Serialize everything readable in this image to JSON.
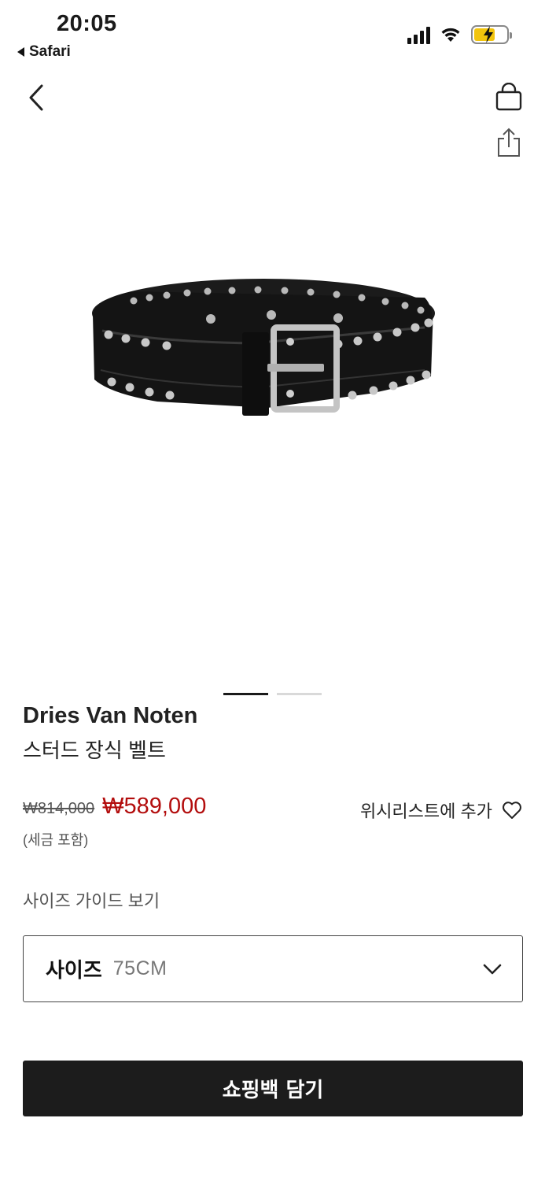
{
  "status_bar": {
    "time": "20:05",
    "back_app": "Safari",
    "icons": [
      "signal-icon",
      "wifi-icon",
      "battery-charging-icon"
    ],
    "battery_color": "#f2c40c"
  },
  "nav": {
    "back_icon": "chevron-left-icon",
    "bag_icon": "shopping-bag-icon",
    "share_icon": "share-icon"
  },
  "product": {
    "image": "studded-black-belt",
    "pager": {
      "total": 2,
      "active": 1
    },
    "brand": "Dries Van Noten",
    "name": "스터드 장식 벨트",
    "original_price": "₩814,000",
    "sale_price": "₩589,000",
    "sale_color": "#b30d0d",
    "tax_note": "(세금 포함)"
  },
  "wishlist": {
    "label": "위시리스트에 추가",
    "icon": "heart-outline-icon"
  },
  "size_guide": {
    "label": "사이즈 가이드 보기"
  },
  "size_select": {
    "label": "사이즈",
    "value": "75CM",
    "icon": "chevron-down-icon"
  },
  "cta": {
    "label": "쇼핑백 담기",
    "background": "#1c1c1c"
  }
}
